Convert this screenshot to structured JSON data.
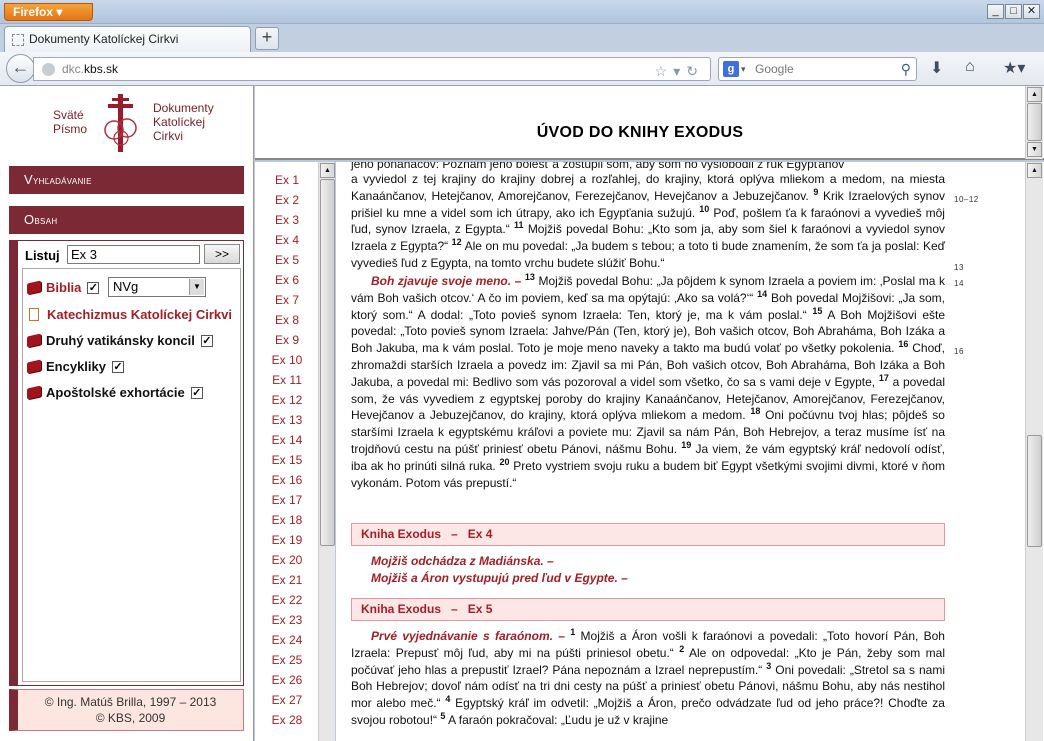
{
  "browser": {
    "menu_button": "Firefox",
    "window_buttons": [
      "_",
      "□",
      "✕"
    ],
    "tab_title": "Dokumenty Katolíckej Cirkvi",
    "new_tab": "+",
    "url_prefix": "dkc.",
    "url_domain": "kbs.sk",
    "search_placeholder": "Google"
  },
  "logo": {
    "left_line1": "Sväté",
    "left_line2": "Písmo",
    "right_line1": "Dokumenty",
    "right_line2": "Katolíckej",
    "right_line3": "Cirkvi"
  },
  "menu": {
    "search_cap": "V",
    "search_rest": "yhľadávanie",
    "content_cap": "O",
    "content_rest": "bsah"
  },
  "listuj": {
    "label": "Listuj",
    "value": "Ex 3",
    "button": ">>"
  },
  "sources": {
    "biblia": "Biblia",
    "translation": "NVg",
    "katechizmus": "Katechizmus Katolíckej Cirkvi",
    "koncil": "Druhý vatikánsky koncil",
    "encykliky": "Encykliky",
    "exhortacie": "Apoštolské exhortácie",
    "checked": "✓"
  },
  "copyright": {
    "line1": "© Ing. Matúš Brilla, 1997 – 2013",
    "line2": "© KBS, 2009"
  },
  "page_title": "ÚVOD DO KNIHY EXODUS",
  "chapters": [
    "Ex 1",
    "Ex 2",
    "Ex 3",
    "Ex 4",
    "Ex 5",
    "Ex 6",
    "Ex 7",
    "Ex 8",
    "Ex 9",
    "Ex 10",
    "Ex 11",
    "Ex 12",
    "Ex 13",
    "Ex 14",
    "Ex 15",
    "Ex 16",
    "Ex 17",
    "Ex 18",
    "Ex 19",
    "Ex 20",
    "Ex 21",
    "Ex 22",
    "Ex 23",
    "Ex 24",
    "Ex 25",
    "Ex 26",
    "Ex 27",
    "Ex 28"
  ],
  "text": {
    "p1_top": "jeho ponáhačov: Poznám jeho bolesť a zostúpil som, aby som ho vyslobodil z rúk Egypťanov",
    "p1a": "a vyviedol z tej krajiny do krajiny dobrej a rozľahlej, do krajiny, ktorá oplýva mliekom a medom, na miesta Kanaánčanov, Hetejčanov, Amorejčanov, Ferezejčanov, Hevejčanov a Jebuzejčanov.",
    "v9": "9",
    "p1b": "Krik Izraelových synov prišiel ku mne a videl som ich útrapy, ako ich Egypťania sužujú.",
    "v10": "10",
    "p1c": "Poď, pošlem ťa k faraónovi a vyvedieš môj ľud, synov Izraela, z Egypta.“",
    "v11": "11",
    "p1d": "Mojžiš povedal Bohu: „Kto som ja, aby som šiel k faraónovi a vyviedol synov Izraela z Egypta?“",
    "v12": "12",
    "p1e": "Ale on mu povedal: „Ja budem s tebou; a toto ti bude znamením, že som ťa ja poslal: Keď vyvedieš ľud z Egypta, na tomto vrchu budete slúžiť Bohu.“",
    "h2": "Boh zjavuje svoje meno. –",
    "v13": "13",
    "p2a": "Mojžiš povedal Bohu: „Ja pôjdem k synom Izraela a poviem im: ‚Poslal ma k vám Boh vašich otcov.‘ A čo im poviem, keď sa ma opýtajú: ‚Ako sa volá?‘“",
    "v14": "14",
    "p2b": "Boh povedal Mojžišovi: „Ja som, ktorý som.“ A dodal: „Toto povieš synom Izraela: Ten, ktorý je, ma k vám poslal.“",
    "v15": "15",
    "p2c": "A Boh Mojžišovi ešte povedal: „Toto povieš synom Izraela: Jahve/Pán (Ten, ktorý je), Boh vašich otcov, Boh Abraháma, Boh Izáka a Boh Jakuba, ma k vám poslal. Toto je moje meno naveky a takto ma budú volať po všetky pokolenia.",
    "v16": "16",
    "p2d": "Choď, zhromaždi starších Izraela a povedz im: Zjavil sa mi Pán, Boh vašich otcov, Boh Abraháma, Boh Izáka a Boh Jakuba, a povedal mi: Bedlivo som vás pozoroval a videl som všetko, čo sa s vami deje v Egypte,",
    "v17": "17",
    "p2e": "a povedal som, že vás vyvediem z egyptskej poroby do krajiny Kanaánčanov, Hetejčanov, Amorejčanov, Ferezejčanov, Hevejčanov a Jebuzejčanov, do krajiny, ktorá oplýva mliekom a medom.",
    "v18": "18",
    "p2f": "Oni počúvnu tvoj hlas; pôjdeš so staršími Izraela k egyptskému kráľovi a poviete mu: Zjavil sa nám Pán, Boh Hebrejov, a teraz musíme ísť na trojdňovú cestu na púšť priniesť obetu Pánovi, nášmu Bohu.",
    "v19": "19",
    "p2g": "Ja viem, že vám egyptský kráľ nedovolí odísť, iba ak ho prinúti silná ruka.",
    "v20": "20",
    "p2h": "Preto vystriem svoju ruku a budem biť Egypt všetkými svojimi divmi, ktoré v ňom vykonám. Potom vás prepustí.“",
    "bar4_book": "Kniha Exodus",
    "bar4_dash": "–",
    "bar4_ch": "Ex 4",
    "h4a": "Mojžiš odchádza z Madiánska. –",
    "h4b": "Mojžiš a Áron vystupujú pred ľud v Egypte. –",
    "bar5_book": "Kniha Exodus",
    "bar5_dash": "–",
    "bar5_ch": "Ex 5",
    "h5": "Prvé vyjednávanie s faraónom. –",
    "v1": "1",
    "p5a": "Mojžiš a Áron vošli k faraónovi a povedali: „Toto hovorí Pán, Boh Izraela: Prepusť môj ľud, aby mi na púšti priniesol obetu.“",
    "v2": "2",
    "p5b": "Ale on odpovedal: „Kto je Pán, žeby som mal počúvať jeho hlas a prepustiť Izrael? Pána nepoznám a Izrael neprepustím.“",
    "v3": "3",
    "p5c": "Oni povedali: „Stretol sa s nami Boh Hebrejov; dovoľ nám odísť na tri dni cesty na púšť a priniesť obetu Pánovi, nášmu Bohu, aby nás nestihol mor alebo meč.“",
    "v4": "4",
    "p5d": "Egyptský kráľ im odvetil: „Mojžiš a Áron, prečo odvádzate ľud od jeho práce?! Choďte za svojou robotou!“",
    "v5": "5",
    "p5e": "A faraón pokračoval: „Ľudu je už v krajine"
  },
  "margin_refs": {
    "r1": "10–12",
    "r2": "13",
    "r3": "14",
    "r4": "16"
  }
}
